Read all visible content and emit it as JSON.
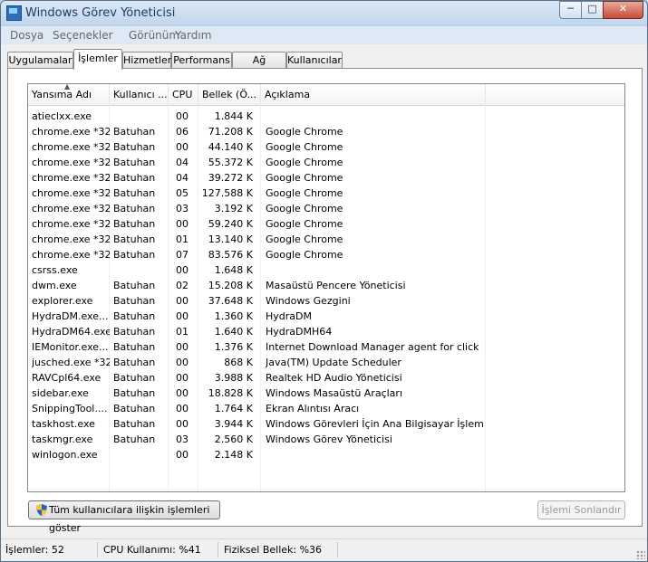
{
  "window": {
    "title": "Windows Görev Yöneticisi"
  },
  "menu": [
    "Dosya",
    "Seçenekler",
    "Görünüm",
    "Yardım"
  ],
  "tabs": [
    {
      "label": "Uygulamalar"
    },
    {
      "label": "İşlemler",
      "active": true
    },
    {
      "label": "Hizmetler"
    },
    {
      "label": "Performans"
    },
    {
      "label": "Ağ İletişimi"
    },
    {
      "label": "Kullanıcılar"
    }
  ],
  "columns": {
    "name": "Yansıma Adı",
    "user": "Kullanıcı ...",
    "cpu": "CPU",
    "memory": "Bellek (Ö...",
    "description": "Açıklama"
  },
  "processes": [
    {
      "name": "atieclxx.exe",
      "user": "",
      "cpu": "00",
      "memory": "1.844 K",
      "description": ""
    },
    {
      "name": "chrome.exe *32",
      "user": "Batuhan",
      "cpu": "06",
      "memory": "71.208 K",
      "description": "Google Chrome"
    },
    {
      "name": "chrome.exe *32",
      "user": "Batuhan",
      "cpu": "00",
      "memory": "44.140 K",
      "description": "Google Chrome"
    },
    {
      "name": "chrome.exe *32",
      "user": "Batuhan",
      "cpu": "04",
      "memory": "55.372 K",
      "description": "Google Chrome"
    },
    {
      "name": "chrome.exe *32",
      "user": "Batuhan",
      "cpu": "04",
      "memory": "39.272 K",
      "description": "Google Chrome"
    },
    {
      "name": "chrome.exe *32",
      "user": "Batuhan",
      "cpu": "05",
      "memory": "127.588 K",
      "description": "Google Chrome"
    },
    {
      "name": "chrome.exe *32",
      "user": "Batuhan",
      "cpu": "03",
      "memory": "3.192 K",
      "description": "Google Chrome"
    },
    {
      "name": "chrome.exe *32",
      "user": "Batuhan",
      "cpu": "00",
      "memory": "59.240 K",
      "description": "Google Chrome"
    },
    {
      "name": "chrome.exe *32",
      "user": "Batuhan",
      "cpu": "01",
      "memory": "13.140 K",
      "description": "Google Chrome"
    },
    {
      "name": "chrome.exe *32",
      "user": "Batuhan",
      "cpu": "07",
      "memory": "83.576 K",
      "description": "Google Chrome"
    },
    {
      "name": "csrss.exe",
      "user": "",
      "cpu": "00",
      "memory": "1.648 K",
      "description": ""
    },
    {
      "name": "dwm.exe",
      "user": "Batuhan",
      "cpu": "02",
      "memory": "15.208 K",
      "description": "Masaüstü Pencere Yöneticisi"
    },
    {
      "name": "explorer.exe",
      "user": "Batuhan",
      "cpu": "00",
      "memory": "37.648 K",
      "description": "Windows Gezgini"
    },
    {
      "name": "HydraDM.exe...",
      "user": "Batuhan",
      "cpu": "00",
      "memory": "1.360 K",
      "description": "HydraDM"
    },
    {
      "name": "HydraDM64.exe",
      "user": "Batuhan",
      "cpu": "01",
      "memory": "1.640 K",
      "description": "HydraDMH64"
    },
    {
      "name": "IEMonitor.exe...",
      "user": "Batuhan",
      "cpu": "00",
      "memory": "1.376 K",
      "description": "Internet Download Manager agent for click m..."
    },
    {
      "name": "jusched.exe *32",
      "user": "Batuhan",
      "cpu": "00",
      "memory": "868 K",
      "description": "Java(TM) Update Scheduler"
    },
    {
      "name": "RAVCpl64.exe",
      "user": "Batuhan",
      "cpu": "00",
      "memory": "3.988 K",
      "description": "Realtek HD Audio Yöneticisi"
    },
    {
      "name": "sidebar.exe",
      "user": "Batuhan",
      "cpu": "00",
      "memory": "18.828 K",
      "description": "Windows Masaüstü Araçları"
    },
    {
      "name": "SnippingTool....",
      "user": "Batuhan",
      "cpu": "00",
      "memory": "1.764 K",
      "description": "Ekran Alıntısı Aracı"
    },
    {
      "name": "taskhost.exe",
      "user": "Batuhan",
      "cpu": "00",
      "memory": "3.944 K",
      "description": "Windows Görevleri İçin Ana Bilgisayar İşlemi"
    },
    {
      "name": "taskmgr.exe",
      "user": "Batuhan",
      "cpu": "03",
      "memory": "2.560 K",
      "description": "Windows Görev Yöneticisi"
    },
    {
      "name": "winlogon.exe",
      "user": "",
      "cpu": "00",
      "memory": "2.148 K",
      "description": ""
    }
  ],
  "buttons": {
    "show_all": "Tüm kullanıcılara ilişkin işlemleri göster",
    "end_process": "İşlemi Sonlandır"
  },
  "status": {
    "processes": "İşlemler: 52",
    "cpu": "CPU Kullanımı: %41",
    "memory": "Fiziksel Bellek: %36"
  },
  "icons": {
    "app": "task-manager-icon",
    "shield": "uac-shield-icon"
  },
  "colors": {
    "frame": "#b9d1ea",
    "close_button": "#c74c35"
  }
}
